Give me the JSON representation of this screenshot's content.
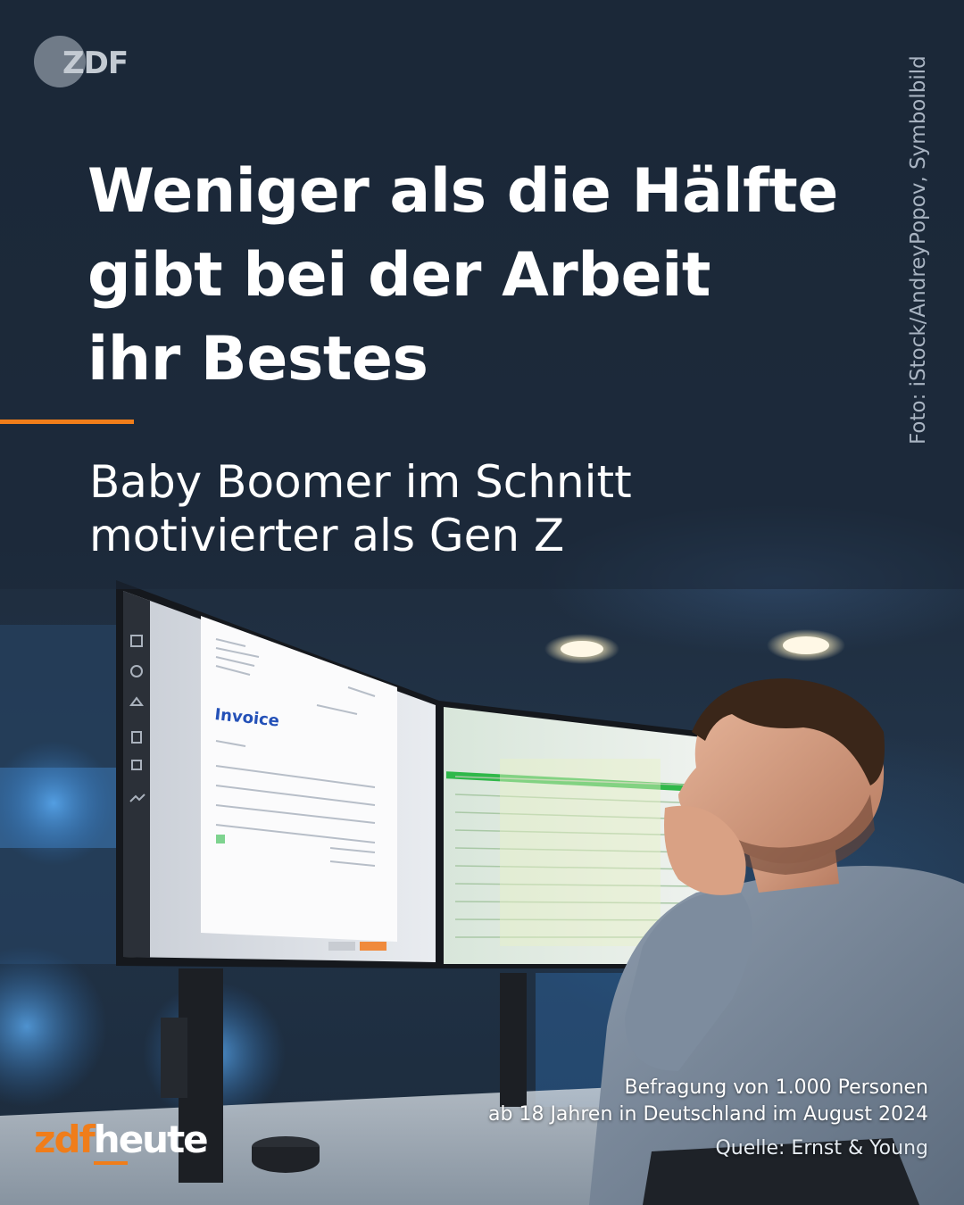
{
  "brand": {
    "channel_logo": "ZDF",
    "wordmark_prefix": "zdf",
    "wordmark_suffix": "heute",
    "accent_color": "#f07d1a"
  },
  "headline": {
    "lines": [
      "Weniger als die Hälfte",
      "gibt bei der Arbeit",
      "ihr Bestes"
    ]
  },
  "subheadline": {
    "lines": [
      "Baby Boomer im Schnitt",
      "motivierter als Gen Z"
    ]
  },
  "photo_credit": "Foto: iStock/AndreyPopov, Symbolbild",
  "survey_note": {
    "lines": [
      "Befragung von 1.000 Personen",
      "ab 18 Jahren in Deutschland im August 2024"
    ],
    "source": "Quelle: Ernst & Young"
  },
  "monitor_screen": {
    "invoice_title": "Invoice"
  }
}
